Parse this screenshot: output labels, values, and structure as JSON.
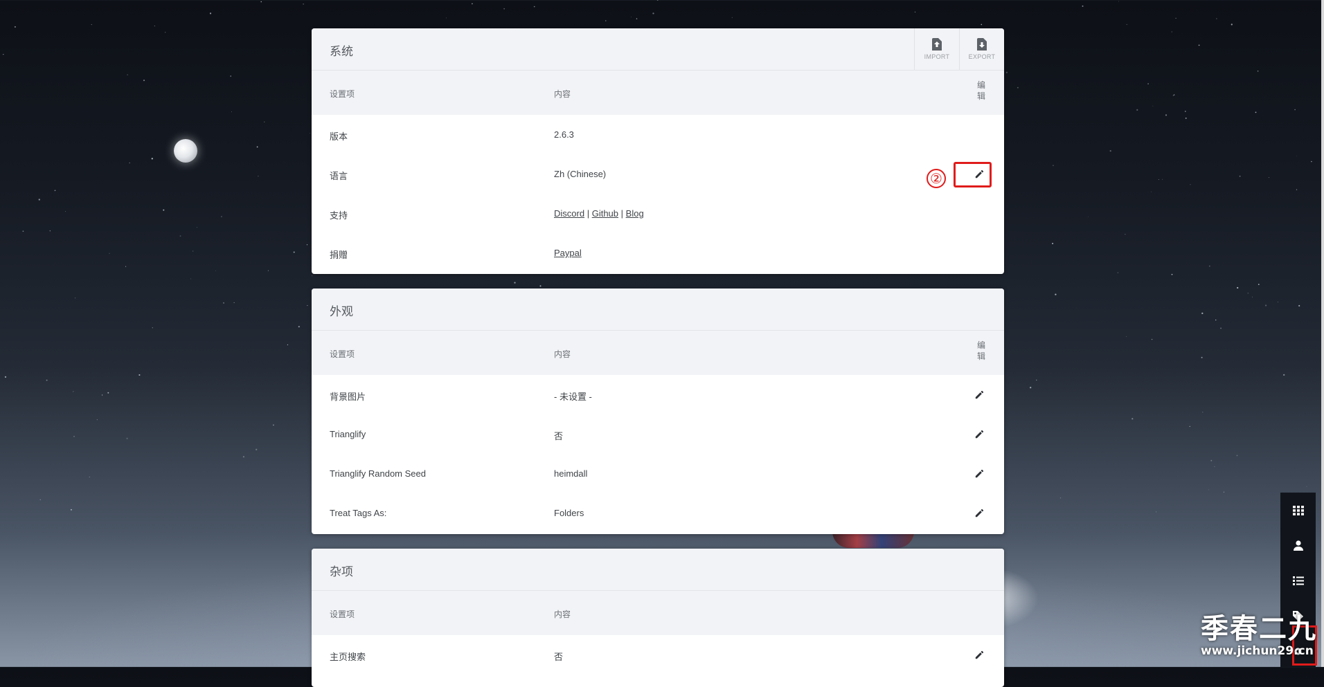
{
  "sections": [
    {
      "title": "系统",
      "header_buttons": [
        {
          "label": "IMPORT",
          "icon": "import-icon"
        },
        {
          "label": "EXPORT",
          "icon": "export-icon"
        }
      ],
      "columns": {
        "key": "设置项",
        "value": "内容",
        "edit": "编辑"
      },
      "rows": [
        {
          "key": "版本",
          "value": "2.6.3"
        },
        {
          "key": "语言",
          "value": "Zh (Chinese)"
        },
        {
          "key": "支持",
          "links": [
            "Discord",
            "Github",
            "Blog"
          ],
          "separator": "|"
        },
        {
          "key": "捐赠",
          "links": [
            "Paypal"
          ]
        }
      ]
    },
    {
      "title": "外观",
      "columns": {
        "key": "设置项",
        "value": "内容",
        "edit": "编辑"
      },
      "rows": [
        {
          "key": "背景图片",
          "value": "- 未设置 -"
        },
        {
          "key": "Trianglify",
          "value": "否"
        },
        {
          "key": "Trianglify Random Seed",
          "value": "heimdall"
        },
        {
          "key": "Treat Tags As:",
          "value": "Folders"
        }
      ]
    },
    {
      "title": "杂项",
      "columns": {
        "key": "设置项",
        "value": "内容"
      },
      "rows": [
        {
          "key": "主页搜索",
          "value": "否"
        }
      ]
    }
  ],
  "annotation": {
    "number": "②",
    "color": "#e01b1b"
  },
  "side_menu": [
    "grid-icon",
    "user-icon",
    "list-icon",
    "tag-icon",
    "settings-icon"
  ],
  "watermark": {
    "title": "季春二九",
    "url": "www.jichun29.cn"
  },
  "colors": {
    "card_header_bg": "#f2f3f6",
    "highlight": "#e01b1b",
    "side_menu_bg": "#11151b"
  }
}
